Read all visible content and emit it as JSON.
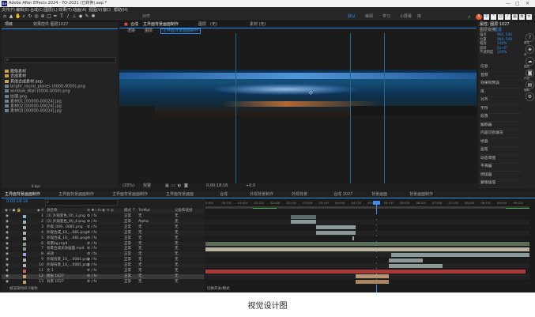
{
  "window": {
    "title": "Adobe After Effects 2024 - YO-2021 (已转换).aep *",
    "ae_badge": "Ae",
    "min": "—",
    "max": "□",
    "close": "✕"
  },
  "menu": [
    "文件(F)",
    "编辑(E)",
    "合成(C)",
    "图层(L)",
    "效果(T)",
    "动画(A)",
    "视图(V)",
    "窗口",
    "帮助(H)"
  ],
  "toolbar": {
    "snap_label": "对齐",
    "workspace_tabs": [
      "默认",
      "审阅",
      "学习",
      "小屏幕",
      "库"
    ],
    "search_icon": "search-icon"
  },
  "sogou": {
    "logo": "S",
    "mode": "中"
  },
  "project_panel": {
    "tab": "项目",
    "tab2": "效果控件 图层1027",
    "search_placeholder": "",
    "items": [
      {
        "name": "图像素材",
        "type": "folder"
      },
      {
        "name": "合成素材",
        "type": "folder"
      },
      {
        "name": "其他合成素材.aep",
        "type": "folder"
      },
      {
        "name": "bright_round_planes (0000-0000).png",
        "type": "file"
      },
      {
        "name": "window_Wall (0000-0000).png",
        "type": "file"
      },
      {
        "name": "纹理.png",
        "type": "file"
      },
      {
        "name": "素材01 [00000-00024].jpg",
        "type": "file"
      },
      {
        "name": "素材02 [00000-00024].jpg",
        "type": "file"
      },
      {
        "name": "素材03 [00000-00024].jpg",
        "type": "file"
      }
    ],
    "footer": "8 bpc"
  },
  "comp_panel": {
    "tabs": [
      "合成",
      "主界面背景画面制作",
      "图层",
      "(无)"
    ],
    "tab_right": "素材 (无)",
    "breadcrumb": [
      "渲染",
      "图层",
      "主界面背景画面制作"
    ],
    "footer_zoom": "(33%)",
    "footer_res": "完整",
    "footer_time": "0:00:18:16",
    "footer_plus": "+0.0"
  },
  "right_panel": {
    "header": "属性: 图层 1027",
    "mini_tabs": [
      "图层变换",
      "重置"
    ],
    "props": [
      {
        "label": "锚点",
        "value": "960, 540"
      },
      {
        "label": "位置",
        "value": "960, 540"
      },
      {
        "label": "缩放",
        "value": "100%"
      },
      {
        "label": "旋转",
        "value": "0x+0°"
      },
      {
        "label": "不透明度",
        "value": "100%"
      }
    ],
    "effects": [
      "信息",
      "音频",
      "效果和预设",
      "库",
      "对齐",
      "字符",
      "段落",
      "跟踪器",
      "内容识别填充",
      "绘画",
      "画笔",
      "动态草图",
      "平滑器",
      "摇摆器",
      "蒙版插值"
    ],
    "side_icons": [
      "help-icon",
      "learn-icon",
      "cloud-icon",
      "camera-icon",
      "book-icon",
      "gear-icon"
    ],
    "side_labels": [
      "属性",
      "库",
      "图层",
      "内容",
      "辅助"
    ]
  },
  "timeline": {
    "comp_tabs": [
      "主界面背景画面制作",
      "主界面背景画面制作",
      "主界面背景画面制作",
      "主界面背景画面",
      "合成",
      "外观背景制作",
      "外观背景",
      "合成 1027",
      "背景画面",
      "背景画面制作"
    ],
    "timecode": "0:00:18:16",
    "col_headers": [
      "源名称",
      "模式",
      "T",
      "TrkMat",
      "父级和链接"
    ],
    "layers": [
      {
        "num": "1",
        "name": "[1] 外观底色_00_3.png",
        "mode": "正常",
        "trk": "无",
        "par": "无",
        "color": "#8fb3c8"
      },
      {
        "num": "2",
        "name": "[2] 外观底色_00_4.png",
        "mode": "正常",
        "trk": "Alpha",
        "par": "无",
        "color": "#8fb3c8"
      },
      {
        "num": "3",
        "name": "外观_009...0081.png",
        "mode": "正常",
        "trk": "无",
        "par": "无",
        "color": "#b0b0b0"
      },
      {
        "num": "4",
        "name": "外观合成_10_...081.png",
        "mode": "正常",
        "trk": "无",
        "par": "无",
        "color": "#b0b0b0"
      },
      {
        "num": "5",
        "name": "外观合成_10_...081.png",
        "mode": "正常",
        "trk": "无",
        "par": "无",
        "color": "#b0b0b0"
      },
      {
        "num": "6",
        "name": "背景bg.mp4",
        "mode": "正常",
        "trk": "无",
        "par": "无",
        "color": "#7fa37f"
      },
      {
        "num": "7",
        "name": "背景合成光效画面.mp4",
        "mode": "正常",
        "trk": "无",
        "par": "无",
        "color": "#7fa37f"
      },
      {
        "num": "8",
        "name": "光效",
        "mode": "正常",
        "trk": "无",
        "par": "无",
        "color": "#a89be0"
      },
      {
        "num": "9",
        "name": "外观背景_10_...0081.png",
        "mode": "正常",
        "trk": "无",
        "par": "无",
        "color": "#b0b0b0"
      },
      {
        "num": "10",
        "name": "外观背景_10_...0081.png",
        "mode": "正常",
        "trk": "无",
        "par": "无",
        "color": "#b0b0b0"
      },
      {
        "num": "11",
        "name": "文 1",
        "mode": "正常",
        "trk": "无",
        "par": "无",
        "color": "#c06060"
      },
      {
        "num": "12",
        "name": "图层 1027",
        "mode": "正常",
        "trk": "无",
        "par": "无",
        "color": "#c8a070"
      },
      {
        "num": "13",
        "name": "背景 1027",
        "mode": "正常",
        "trk": "无",
        "par": "无",
        "color": "#c8a070"
      }
    ],
    "ruler": [
      "0:00f",
      "00:15f",
      "01:00f",
      "01:15f",
      "02:00f",
      "02:15f",
      "03:00f",
      "03:15f",
      "04:00f",
      "04:15f",
      "05:00f",
      "05:15f",
      "06:00f",
      "06:15f",
      "07:00f",
      "07:15f",
      "08:00f",
      "08:15f",
      "09:00f",
      "09:15f"
    ],
    "bottom_bar": "帧渲染时间 0毫秒",
    "bottom_right": "切换开关/模式"
  },
  "caption": "视觉设计图"
}
